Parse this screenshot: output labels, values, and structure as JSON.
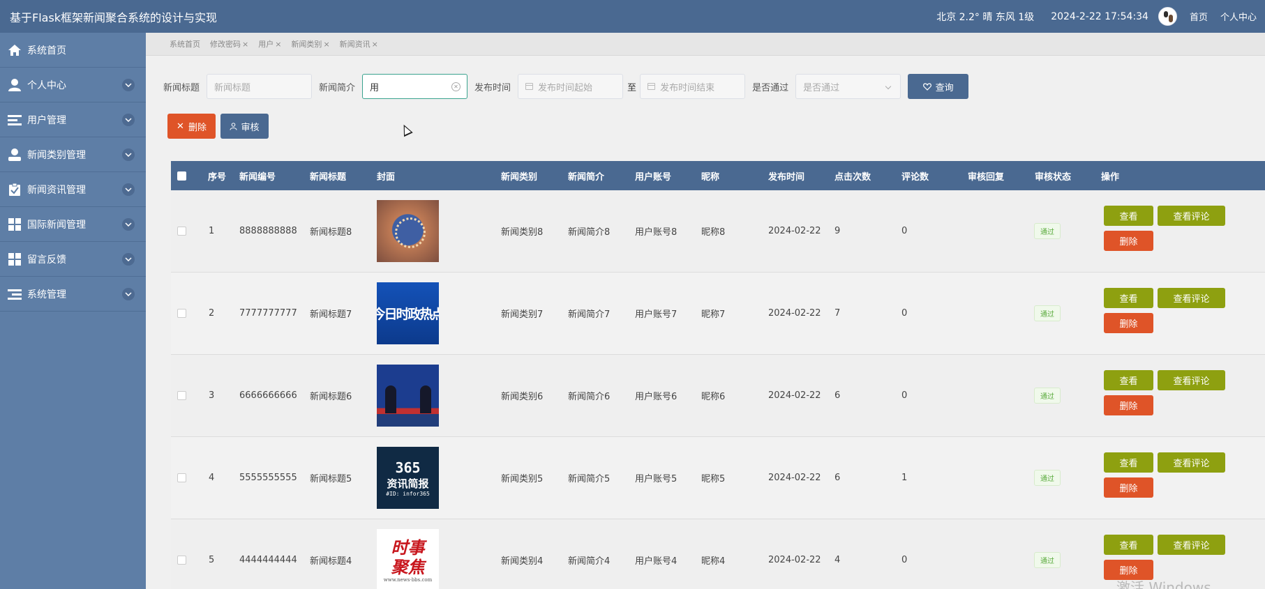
{
  "header": {
    "title": "基于Flask框架新闻聚合系统的设计与实现",
    "weather": "北京  2.2°  晴  东风  1级",
    "datetime": "2024-2-22 17:54:34",
    "nav_home": "首页",
    "nav_profile": "个人中心"
  },
  "sidebar": {
    "items": [
      {
        "label": "系统首页",
        "icon": "home-icon"
      },
      {
        "label": "个人中心",
        "icon": "user-icon"
      },
      {
        "label": "用户管理",
        "icon": "list-icon"
      },
      {
        "label": "新闻类别管理",
        "icon": "user-group-icon"
      },
      {
        "label": "新闻资讯管理",
        "icon": "clipboard-check-icon"
      },
      {
        "label": "国际新闻管理",
        "icon": "grid-icon"
      },
      {
        "label": "留言反馈",
        "icon": "grid-icon"
      },
      {
        "label": "系统管理",
        "icon": "list-icon"
      }
    ]
  },
  "tabs": [
    {
      "label": "系统首页",
      "closable": false
    },
    {
      "label": "修改密码",
      "closable": true
    },
    {
      "label": "用户",
      "closable": true
    },
    {
      "label": "新闻类别",
      "closable": true
    },
    {
      "label": "新闻资讯",
      "closable": true
    }
  ],
  "tab_close": "×",
  "search": {
    "title_label": "新闻标题",
    "title_placeholder": "新闻标题",
    "intro_label": "新闻简介",
    "intro_value": "用",
    "time_label": "发布时间",
    "time_start_placeholder": "发布时间起始",
    "to_label": "至",
    "time_end_placeholder": "发布时间结束",
    "passed_label": "是否通过",
    "passed_placeholder": "是否通过",
    "query_label": "查询"
  },
  "toolbar": {
    "delete_label": "删除",
    "audit_label": "审核"
  },
  "table": {
    "columns": [
      "序号",
      "新闻编号",
      "新闻标题",
      "封面",
      "新闻类别",
      "新闻简介",
      "用户账号",
      "昵称",
      "发布时间",
      "点击次数",
      "评论数",
      "审核回复",
      "审核状态",
      "操作"
    ],
    "rows": [
      {
        "index": "1",
        "code": "8888888888",
        "title": "新闻标题8",
        "category": "新闻类别8",
        "intro": "新闻简介8",
        "account": "用户账号8",
        "nickname": "昵称8",
        "date": "2024-02-22",
        "clicks": "9",
        "comments": "0",
        "reply": "",
        "status": "通过",
        "cover": "globe"
      },
      {
        "index": "2",
        "code": "7777777777",
        "title": "新闻标题7",
        "category": "新闻类别7",
        "intro": "新闻简介7",
        "account": "用户账号7",
        "nickname": "昵称7",
        "date": "2024-02-22",
        "clicks": "7",
        "comments": "0",
        "reply": "",
        "status": "通过",
        "cover": "今日时政热点"
      },
      {
        "index": "3",
        "code": "6666666666",
        "title": "新闻标题6",
        "category": "新闻类别6",
        "intro": "新闻简介6",
        "account": "用户账号6",
        "nickname": "昵称6",
        "date": "2024-02-22",
        "clicks": "6",
        "comments": "0",
        "reply": "",
        "status": "通过",
        "cover": "studio"
      },
      {
        "index": "4",
        "code": "5555555555",
        "title": "新闻标题5",
        "category": "新闻类别5",
        "intro": "新闻简介5",
        "account": "用户账号5",
        "nickname": "昵称5",
        "date": "2024-02-22",
        "clicks": "6",
        "comments": "1",
        "reply": "",
        "status": "通过",
        "cover": "365"
      },
      {
        "index": "5",
        "code": "4444444444",
        "title": "新闻标题4",
        "category": "新闻类别4",
        "intro": "新闻简介4",
        "account": "用户账号4",
        "nickname": "昵称4",
        "date": "2024-02-22",
        "clicks": "4",
        "comments": "0",
        "reply": "",
        "status": "通过",
        "cover": "时事聚焦"
      }
    ],
    "op_view": "查看",
    "op_comments": "查看评论",
    "op_delete": "删除"
  },
  "covers": {
    "t7_text": "今日时政热点",
    "t5_line1": "365",
    "t5_line2": "资讯简报",
    "t5_line3": "#ID: infor365",
    "t4_line1": "时事",
    "t4_line2": "聚焦",
    "t4_line3": "www.news-bbs.com"
  },
  "watermark": "激活 Windows",
  "colors": {
    "header": "#4a6991",
    "sidebar": "#5e7ea6",
    "danger": "#df5428",
    "olive": "#8ea010",
    "success": "#5aab3d"
  }
}
